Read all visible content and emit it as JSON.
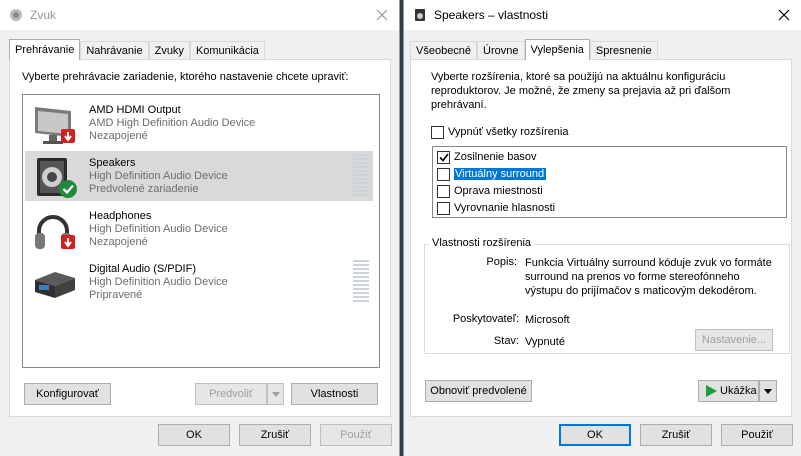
{
  "left_window": {
    "title": "Zvuk",
    "tabs": [
      "Prehrávanie",
      "Nahrávanie",
      "Zvuky",
      "Komunikácia"
    ],
    "intro": "Vyberte prehrávacie zariadenie, ktorého nastavenie chcete upraviť:",
    "devices": [
      {
        "name": "AMD HDMI Output",
        "desc": "AMD High Definition Audio Device",
        "status": "Nezapojené"
      },
      {
        "name": "Speakers",
        "desc": "High Definition Audio Device",
        "status": "Predvolené zariadenie"
      },
      {
        "name": "Headphones",
        "desc": "High Definition Audio Device",
        "status": "Nezapojené"
      },
      {
        "name": "Digital Audio (S/PDIF)",
        "desc": "High Definition Audio Device",
        "status": "Pripravené"
      }
    ],
    "buttons": {
      "configure": "Konfigurovať",
      "set_default": "Predvoliť",
      "properties": "Vlastnosti",
      "ok": "OK",
      "cancel": "Zrušiť",
      "apply": "Použiť"
    }
  },
  "right_window": {
    "title": "Speakers – vlastnosti",
    "tabs": [
      "Všeobecné",
      "Úrovne",
      "Vylepšenia",
      "Spresnenie"
    ],
    "intro": "Vyberte rozšírenia, ktoré sa použijú na aktuálnu konfiguráciu reproduktorov. Je možné, že zmeny sa prejavia až pri ďalšom prehrávaní.",
    "disable_all_label": "Vypnúť všetky rozšírenia",
    "disable_all_checked": false,
    "enhancements": [
      {
        "label": "Zosilnenie basov",
        "checked": true
      },
      {
        "label": "Virtuálny surround",
        "checked": false,
        "selected": true
      },
      {
        "label": "Oprava miestnosti",
        "checked": false
      },
      {
        "label": "Vyrovnanie hlasnosti",
        "checked": false
      }
    ],
    "props_group": {
      "legend": "Vlastnosti rozšírenia",
      "desc_label": "Popis:",
      "desc_value": "Funkcia Virtuálny surround kóduje zvuk vo formáte surround na prenos vo forme stereofónneho výstupu do prijímačov s maticovým dekodérom.",
      "provider_label": "Poskytovateľ:",
      "provider_value": "Microsoft",
      "state_label": "Stav:",
      "state_value": "Vypnuté",
      "settings_button": "Nastavenie..."
    },
    "buttons": {
      "restore": "Obnoviť predvolené",
      "preview": "Ukážka",
      "ok": "OK",
      "cancel": "Zrušiť",
      "apply": "Použiť"
    }
  },
  "colors": {
    "selection": "#0078d7",
    "check_green": "#1e8c3a",
    "badge_red": "#d41f1f"
  },
  "icons": [
    "speaker-icon",
    "close-icon",
    "monitor-icon",
    "speaker-device-icon",
    "headphones-icon",
    "digital-audio-icon",
    "checkmark-icon",
    "play-icon",
    "chevron-down-icon"
  ]
}
